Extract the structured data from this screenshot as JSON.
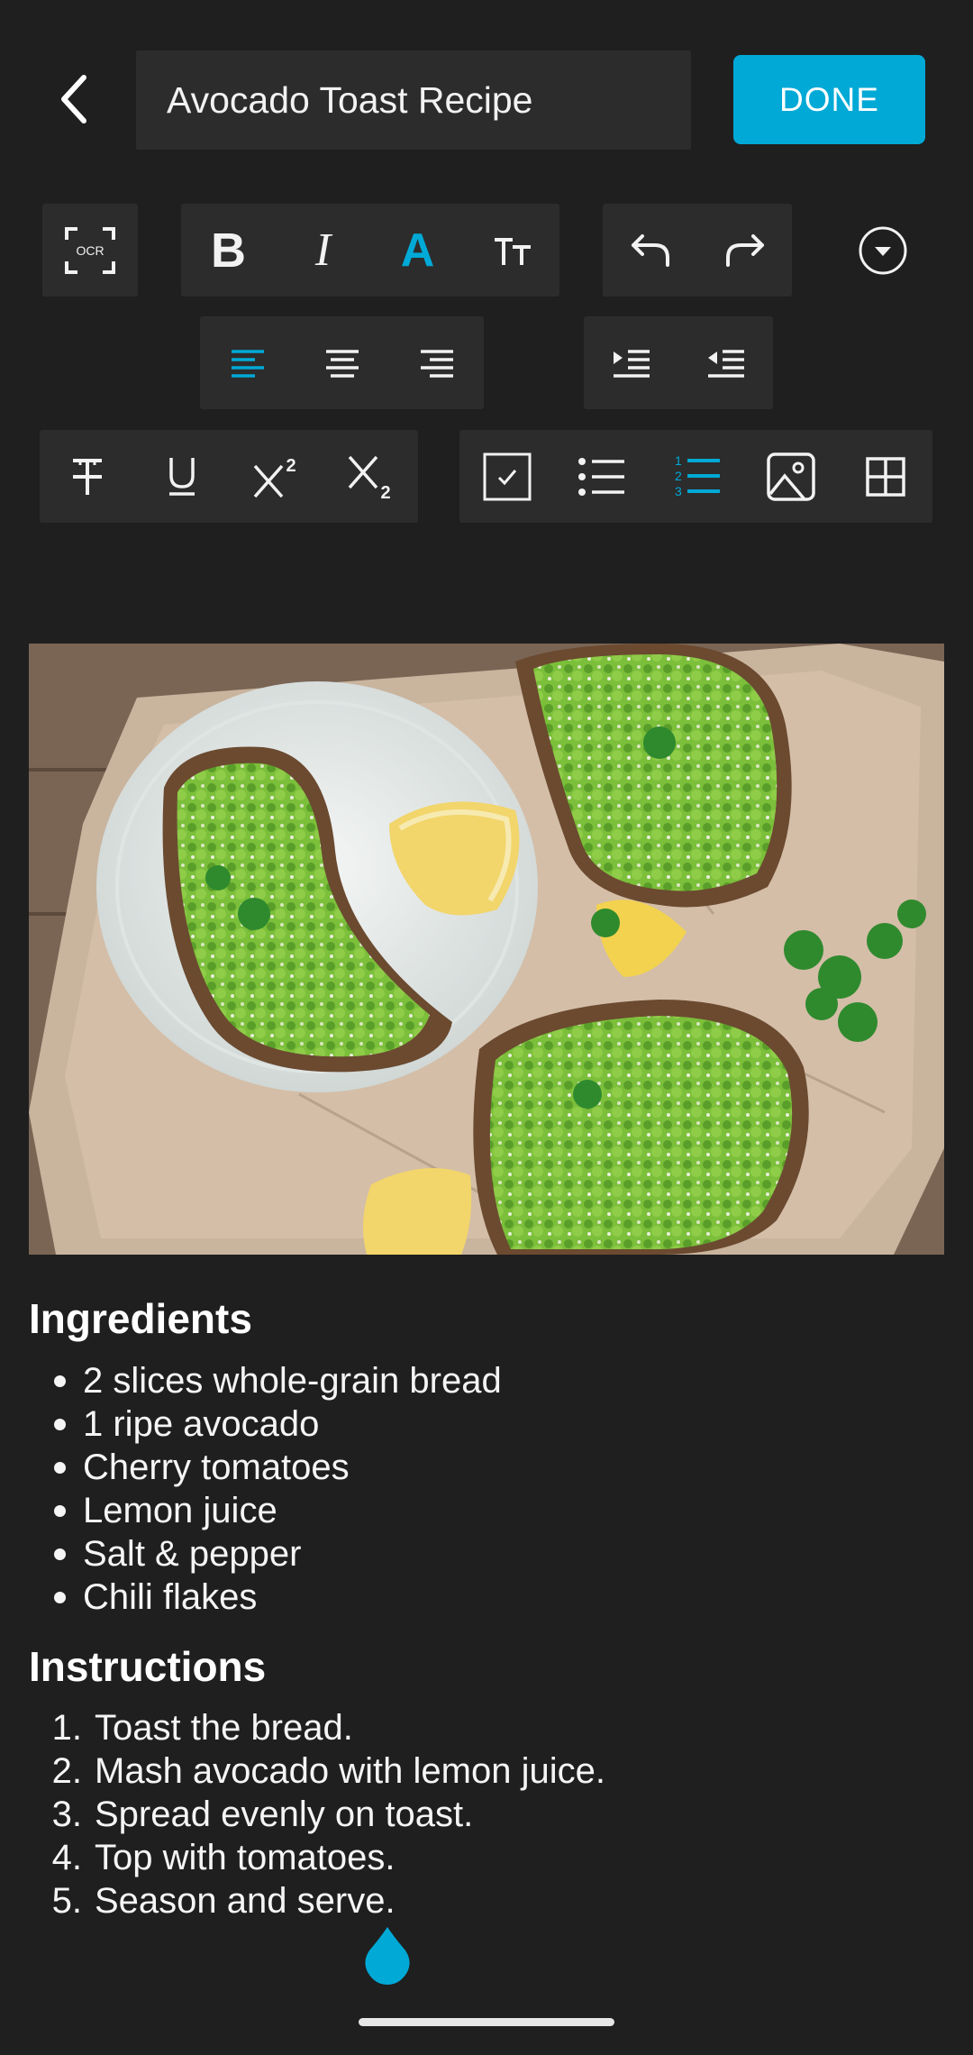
{
  "header": {
    "back_icon": "chevron-left-icon",
    "title_value": "Avocado Toast Recipe",
    "done_label": "DONE"
  },
  "toolbar": {
    "ocr_label": "OCR",
    "bold_glyph": "B",
    "italic_glyph": "I",
    "text_color_glyph": "A",
    "text_size_glyph": "TT",
    "accent_color": "#00a9d6",
    "icons": [
      "ocr-scan-icon",
      "bold-icon",
      "italic-icon",
      "text-color-icon",
      "text-size-icon",
      "undo-icon",
      "redo-icon",
      "more-dropdown-icon",
      "align-left-icon",
      "align-center-icon",
      "align-right-icon",
      "indent-icon",
      "outdent-icon",
      "strikethrough-icon",
      "underline-icon",
      "superscript-icon",
      "subscript-icon",
      "checkbox-icon",
      "bullet-list-icon",
      "numbered-list-icon",
      "insert-image-icon",
      "table-icon"
    ],
    "active": [
      "text-color-icon",
      "align-left-icon",
      "numbered-list-icon"
    ]
  },
  "content": {
    "image_alt": "avocado toast photo",
    "ingredients_heading": "Ingredients",
    "ingredients": [
      "2 slices whole-grain bread",
      "1 ripe avocado",
      "Cherry tomatoes",
      "Lemon juice",
      "Salt & pepper",
      "Chili flakes"
    ],
    "instructions_heading": "Instructions",
    "instructions": [
      {
        "num": "1.",
        "text": "Toast the bread."
      },
      {
        "num": "2.",
        "text": "Mash avocado with lemon juice."
      },
      {
        "num": "3.",
        "text": "Spread evenly on toast."
      },
      {
        "num": "4.",
        "text": "Top with tomatoes."
      },
      {
        "num": "5.",
        "text": "Season and serve."
      }
    ]
  },
  "colors": {
    "background": "#1f1f1f",
    "toolbar_group": "#2c2c2c",
    "accent": "#00a9d6"
  }
}
